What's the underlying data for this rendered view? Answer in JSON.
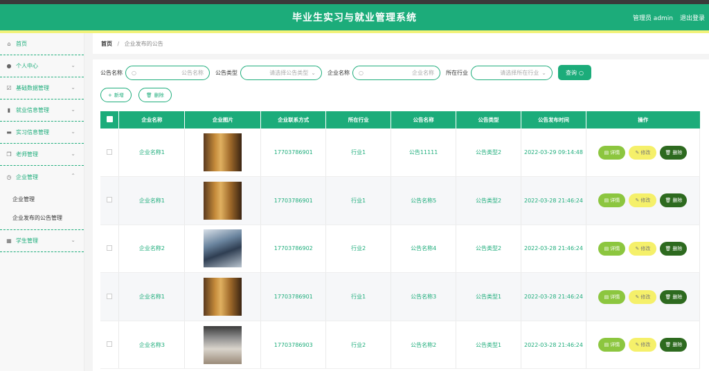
{
  "header": {
    "title": "毕业生实习与就业管理系统",
    "user": "管理员 admin",
    "logout": "退出登录"
  },
  "sidebar": {
    "items": [
      {
        "label": "首页",
        "icon": "home-icon"
      },
      {
        "label": "个人中心",
        "icon": "user-icon"
      },
      {
        "label": "基础数据管理",
        "icon": "checkbox-icon"
      },
      {
        "label": "就业信息管理",
        "icon": "thumb-icon"
      },
      {
        "label": "实习信息管理",
        "icon": "briefcase-icon"
      },
      {
        "label": "老师管理",
        "icon": "copy-icon"
      },
      {
        "label": "企业管理",
        "icon": "clock-icon"
      },
      {
        "label": "学生管理",
        "icon": "grid-icon"
      }
    ],
    "sub": [
      {
        "label": "企业管理"
      },
      {
        "label": "企业发布的公告管理"
      }
    ]
  },
  "breadcrumb": {
    "home": "首页",
    "sep": "/",
    "current": "企业发布的公告"
  },
  "search": {
    "f1_label": "公告名称",
    "f1_ph": "公告名称",
    "f2_label": "公告类型",
    "f2_ph": "请选择公告类型",
    "f3_label": "企业名称",
    "f3_ph": "企业名称",
    "f4_label": "所在行业",
    "f4_ph": "请选择所在行业",
    "query": "查询"
  },
  "actions": {
    "add": "新增",
    "delete": "删除"
  },
  "table": {
    "columns": [
      "企业名称",
      "企业图片",
      "企业联系方式",
      "所在行业",
      "公告名称",
      "公告类型",
      "公告发布时间",
      "操作"
    ],
    "rows": [
      {
        "company": "企业名称1",
        "phone": "17703786901",
        "industry": "行业1",
        "notice": "公告11111",
        "type": "公告类型2",
        "time": "2022-03-29 09:14:48"
      },
      {
        "company": "企业名称1",
        "phone": "17703786901",
        "industry": "行业1",
        "notice": "公告名称5",
        "type": "公告类型2",
        "time": "2022-03-28 21:46:24"
      },
      {
        "company": "企业名称2",
        "phone": "17703786902",
        "industry": "行业2",
        "notice": "公告名称4",
        "type": "公告类型2",
        "time": "2022-03-28 21:46:24"
      },
      {
        "company": "企业名称1",
        "phone": "17703786901",
        "industry": "行业1",
        "notice": "公告名称3",
        "type": "公告类型1",
        "time": "2022-03-28 21:46:24"
      },
      {
        "company": "企业名称3",
        "phone": "17703786903",
        "industry": "行业2",
        "notice": "公告名称2",
        "type": "公告类型1",
        "time": "2022-03-28 21:46:24"
      }
    ],
    "btn_detail": "详情",
    "btn_edit": "修改",
    "btn_delete": "删除"
  },
  "colors": {
    "accent": "#1cac7a",
    "yellow": "#f2f27a",
    "detail": "#8cc63f",
    "edit": "#f5f06a",
    "delete": "#2d6a1f"
  }
}
